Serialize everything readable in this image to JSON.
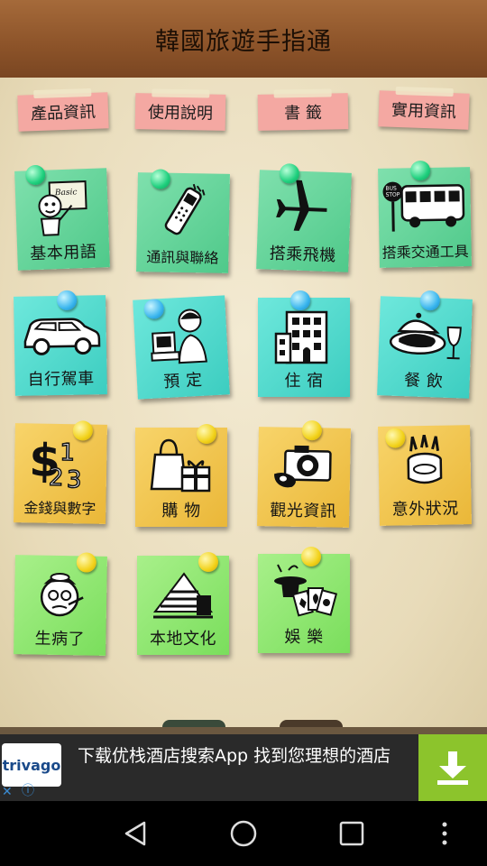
{
  "app": {
    "title": "韓國旅遊手指通"
  },
  "tabs": [
    {
      "label": "產品資訊"
    },
    {
      "label": "使用說明"
    },
    {
      "label": "書 籤"
    },
    {
      "label": "實用資訊"
    }
  ],
  "categories": [
    {
      "label": "基本用語",
      "icon": "basic-phrases-icon",
      "color": "green"
    },
    {
      "label": "通訊與聯絡",
      "icon": "phone-icon",
      "color": "green"
    },
    {
      "label": "搭乘飛機",
      "icon": "airplane-icon",
      "color": "green"
    },
    {
      "label": "搭乘交通工具",
      "icon": "bus-icon",
      "color": "green"
    },
    {
      "label": "自行駕車",
      "icon": "car-icon",
      "color": "teal"
    },
    {
      "label": "預 定",
      "icon": "reservation-icon",
      "color": "teal"
    },
    {
      "label": "住 宿",
      "icon": "hotel-icon",
      "color": "teal"
    },
    {
      "label": "餐 飲",
      "icon": "dining-icon",
      "color": "teal"
    },
    {
      "label": "金錢與數字",
      "icon": "money-numbers-icon",
      "color": "yellow"
    },
    {
      "label": "購 物",
      "icon": "shopping-icon",
      "color": "yellow"
    },
    {
      "label": "觀光資訊",
      "icon": "camera-icon",
      "color": "yellow"
    },
    {
      "label": "意外狀況",
      "icon": "emergency-icon",
      "color": "yellow"
    },
    {
      "label": "生病了",
      "icon": "sick-icon",
      "color": "lime"
    },
    {
      "label": "本地文化",
      "icon": "culture-icon",
      "color": "lime"
    },
    {
      "label": "娛 樂",
      "icon": "entertainment-icon",
      "color": "lime"
    }
  ],
  "ad": {
    "brand": "trivago",
    "text": "下载优栈酒店搜索App 找到您理想的酒店"
  },
  "colors": {
    "title_bar": "#8c5329",
    "tab_note": "#f4a8a2",
    "green_note": "#4fc98a",
    "teal_note": "#3ccdc0",
    "yellow_note": "#eab738",
    "lime_note": "#7ade5c",
    "ad_download": "#8cc42c"
  }
}
